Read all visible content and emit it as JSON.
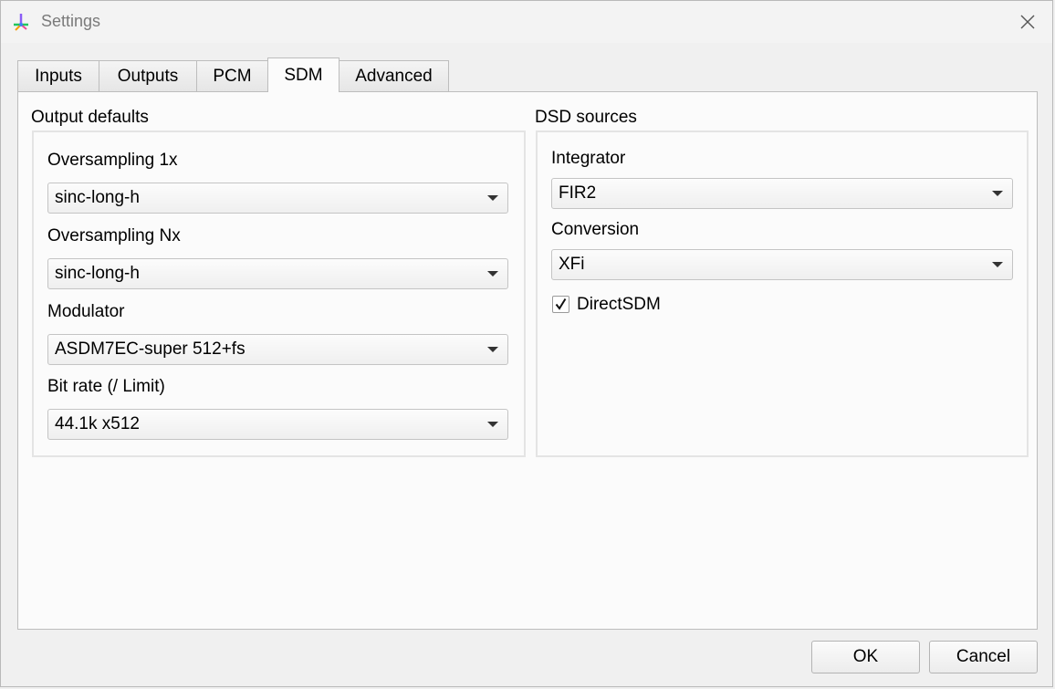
{
  "window": {
    "title": "Settings"
  },
  "tabs": [
    {
      "label": "Inputs",
      "active": false
    },
    {
      "label": "Outputs",
      "active": false
    },
    {
      "label": "PCM",
      "active": false
    },
    {
      "label": "SDM",
      "active": true
    },
    {
      "label": "Advanced",
      "active": false
    }
  ],
  "output_defaults": {
    "title": "Output defaults",
    "oversampling_1x": {
      "label": "Oversampling 1x",
      "value": "sinc-long-h"
    },
    "oversampling_nx": {
      "label": "Oversampling Nx",
      "value": "sinc-long-h"
    },
    "modulator": {
      "label": "Modulator",
      "value": "ASDM7EC-super 512+fs"
    },
    "bit_rate": {
      "label": "Bit rate (/ Limit)",
      "value": "44.1k x512"
    }
  },
  "dsd_sources": {
    "title": "DSD sources",
    "integrator": {
      "label": "Integrator",
      "value": "FIR2"
    },
    "conversion": {
      "label": "Conversion",
      "value": "XFi"
    },
    "direct_sdm": {
      "label": "DirectSDM",
      "checked": true
    }
  },
  "buttons": {
    "ok": "OK",
    "cancel": "Cancel"
  },
  "colors": {
    "window_bg": "#f0f0f0",
    "panel_bg": "#fbfbfb",
    "border": "#bdbdbd"
  }
}
